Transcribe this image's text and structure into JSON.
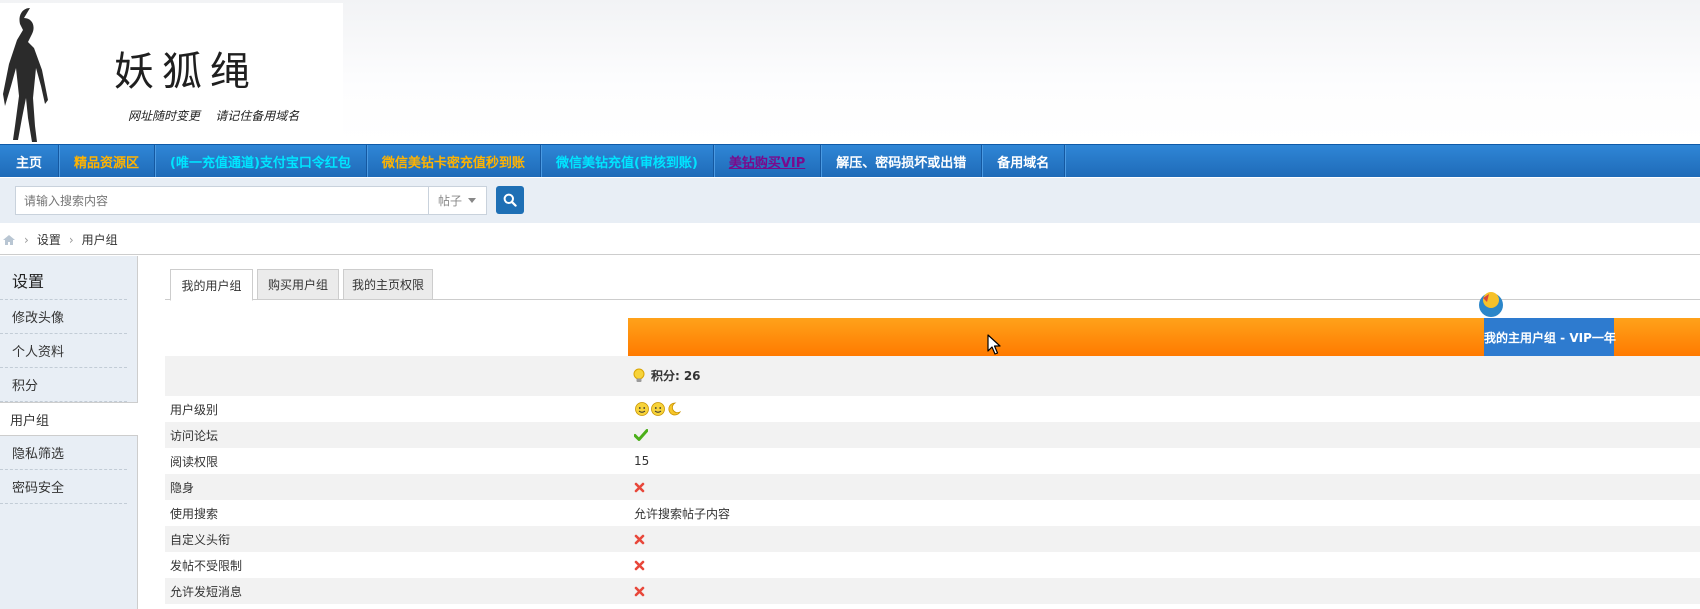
{
  "header": {
    "site_title": "妖狐绳",
    "slogan": "网址随时变更    请记住备用域名"
  },
  "nav": {
    "items": [
      {
        "label": "主页",
        "color": "#ffffff"
      },
      {
        "label": "精品资源区",
        "color": "#ffb300"
      },
      {
        "label": "(唯一充值通道)支付宝口令红包",
        "color": "#00e5ff"
      },
      {
        "label": "微信美钻卡密充值秒到账",
        "color": "#ffb300"
      },
      {
        "label": "微信美钻充值(审核到账)",
        "color": "#00e5ff"
      },
      {
        "label": "美钻购买VIP",
        "color": "#7a0a8c"
      },
      {
        "label": "解压、密码损坏或出错",
        "color": "#ffffff"
      },
      {
        "label": "备用域名",
        "color": "#ffffff"
      }
    ]
  },
  "search": {
    "placeholder": "请输入搜索内容",
    "type_selected": "帖子"
  },
  "breadcrumb": {
    "items": [
      "设置",
      "用户组"
    ]
  },
  "sidebar": {
    "title": "设置",
    "items": [
      {
        "label": "修改头像"
      },
      {
        "label": "个人资料"
      },
      {
        "label": "积分"
      },
      {
        "label": "用户组"
      },
      {
        "label": "隐私筛选"
      },
      {
        "label": "密码安全"
      }
    ]
  },
  "tabs": [
    {
      "label": "我的用户组"
    },
    {
      "label": "购买用户组"
    },
    {
      "label": "我的主页权限"
    }
  ],
  "group": {
    "main_group": "我的主用户组 - VIP一年",
    "points_label": "积分:",
    "points_value": "26"
  },
  "permissions": [
    {
      "label": "用户级别",
      "value_type": "level-icons",
      "value": ""
    },
    {
      "label": "访问论坛",
      "value_type": "check",
      "value": ""
    },
    {
      "label": "阅读权限",
      "value_type": "text",
      "value": "15"
    },
    {
      "label": "隐身",
      "value_type": "cross",
      "value": ""
    },
    {
      "label": "使用搜索",
      "value_type": "text",
      "value": "允许搜索帖子内容"
    },
    {
      "label": "自定义头衔",
      "value_type": "cross",
      "value": ""
    },
    {
      "label": "发帖不受限制",
      "value_type": "cross",
      "value": ""
    },
    {
      "label": "允许发短消息",
      "value_type": "cross",
      "value": ""
    }
  ],
  "colors": {
    "nav_bg": "#2a7cc9",
    "accent_orange": "#ff8a00",
    "group_blue": "#2e7bcf",
    "check_green": "#4caf1a",
    "cross_red": "#e8473a"
  }
}
